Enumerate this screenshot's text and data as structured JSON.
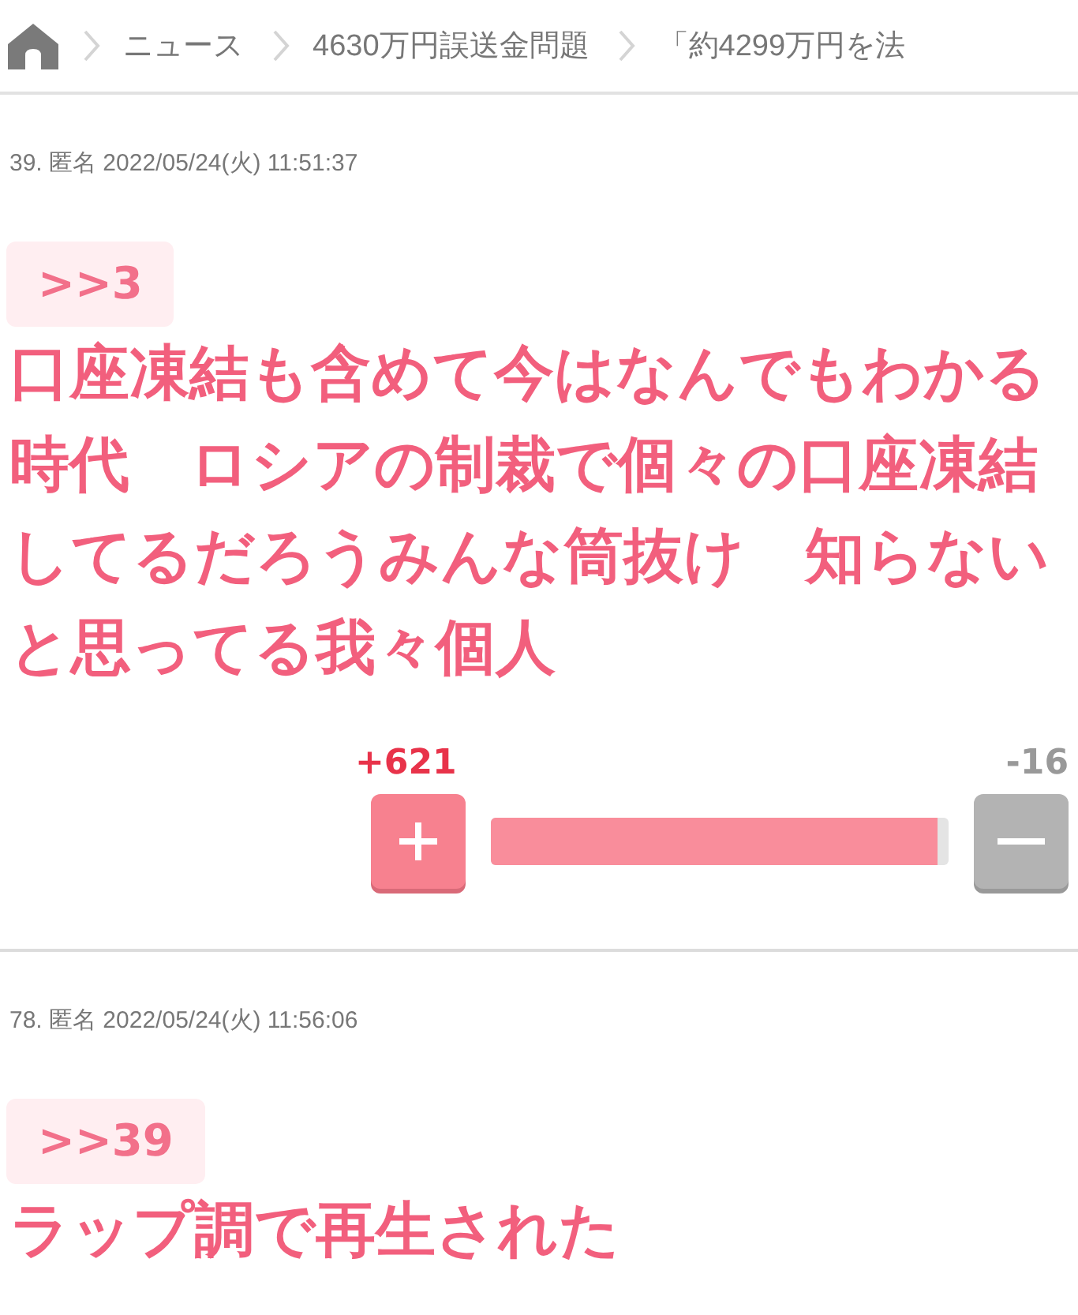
{
  "breadcrumb": [
    "ニュース",
    "4630万円誤送金問題",
    "「約4299万円を法"
  ],
  "posts": [
    {
      "meta": "39. 匿名 2022/05/24(火) 11:51:37",
      "anchor": ">>3",
      "body": "口座凍結も含めて今はなんでもわかる時代　ロシアの制裁で個々の口座凍結してるだろうみんな筒抜け　知らないと思ってる我々個人",
      "votes": {
        "plus": "+621",
        "minus": "-16",
        "level": 0.975
      }
    },
    {
      "meta": "78. 匿名 2022/05/24(火) 11:56:06",
      "anchor": ">>39",
      "body": "ラップ調で再生された"
    }
  ]
}
